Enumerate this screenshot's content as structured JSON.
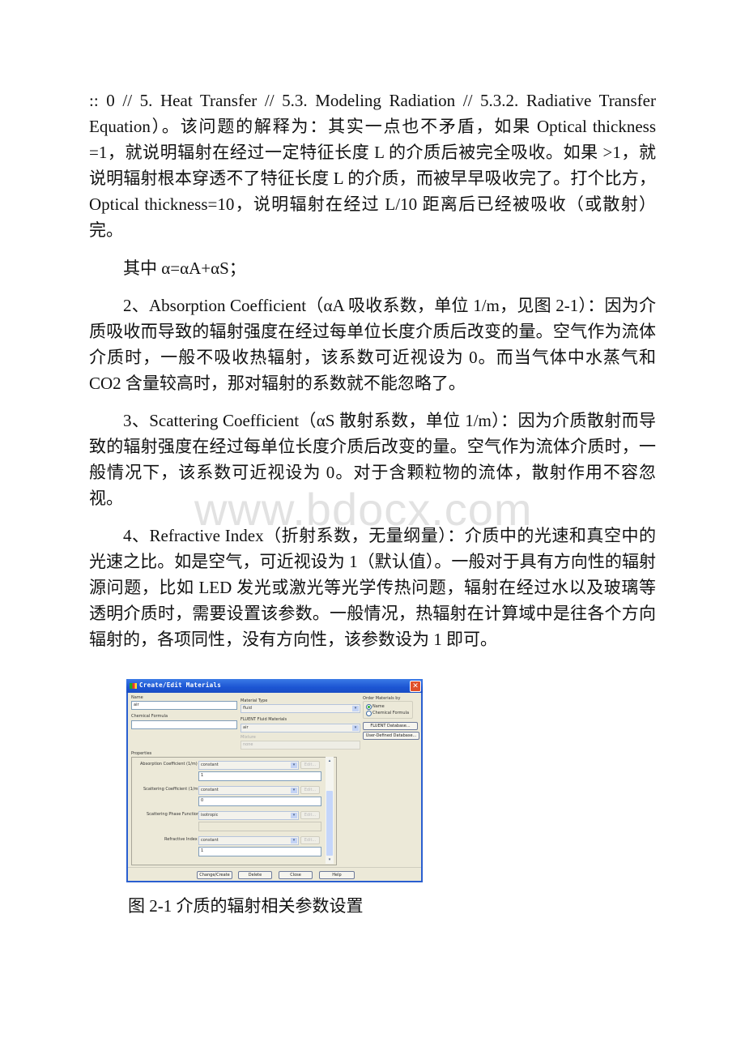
{
  "watermark": "www.bdocx.com",
  "paragraphs": [
    {
      "text": ":: 0 // 5. Heat Transfer // 5.3. Modeling Radiation // 5.3.2. Radiative Transfer Equation）。该问题的解释为：其实一点也不矛盾，如果 Optical thickness =1，就说明辐射在经过一定特征长度 L 的介质后被完全吸收。如果 >1，就说明辐射根本穿透不了特征长度 L 的介质，而被早早吸收完了。打个比方，Optical thickness=10，说明辐射在经过 L/10 距离后已经被吸收（或散射）完。"
    },
    {
      "text": "其中 α=αA+αS；"
    },
    {
      "text": "2、Absorption Coefficient（αA 吸收系数，单位 1/m，见图 2-1）：因为介质吸收而导致的辐射强度在经过每单位长度介质后改变的量。空气作为流体介质时，一般不吸收热辐射，该系数可近视设为 0。而当气体中水蒸气和 CO2 含量较高时，那对辐射的系数就不能忽略了。"
    },
    {
      "text": "3、Scattering Coefficient（αS 散射系数，单位 1/m）：因为介质散射而导致的辐射强度在经过每单位长度介质后改变的量。空气作为流体介质时，一般情况下，该系数可近视设为 0。对于含颗粒物的流体，散射作用不容忽视。"
    },
    {
      "text": "4、Refractive Index（折射系数，无量纲量）：介质中的光速和真空中的光速之比。如是空气，可近视设为 1（默认值）。一般对于具有方向性的辐射源问题，比如 LED 发光或激光等光学传热问题，辐射在经过水以及玻璃等透明介质时，需要设置该参数。一般情况，热辐射在计算域中是往各个方向辐射的，各项同性，没有方向性，该参数设为 1 即可。"
    }
  ],
  "figure": {
    "caption": "图 2-1 介质的辐射相关参数设置",
    "dialog": {
      "title": "Create/Edit Materials",
      "close_glyph": "✕",
      "name_label": "Name",
      "name_value": "air",
      "chemical_formula_label": "Chemical Formula",
      "chemical_formula_value": "",
      "material_type_label": "Material Type",
      "material_type_value": "fluid",
      "fluent_materials_label": "FLUENT Fluid Materials",
      "fluent_materials_value": "air",
      "mixture_label": "Mixture",
      "mixture_value": "none",
      "order_by_label": "Order Materials by",
      "order_by_options": [
        {
          "label": "Name",
          "selected": true
        },
        {
          "label": "Chemical Formula",
          "selected": false
        }
      ],
      "fluent_database_button": "FLUENT Database...",
      "user_database_button": "User-Defined Database...",
      "properties_label": "Properties",
      "properties": [
        {
          "label": "Absorption Coefficient (1/m)",
          "method": "constant",
          "value": "1",
          "edit": "Edit..."
        },
        {
          "label": "Scattering Coefficient (1/m)",
          "method": "constant",
          "value": "0",
          "edit": "Edit..."
        },
        {
          "label": "Scattering Phase Function",
          "method": "isotropic",
          "value": "",
          "edit": "Edit..."
        },
        {
          "label": "Refractive Index",
          "method": "constant",
          "value": "1",
          "edit": "Edit..."
        }
      ],
      "dropdown_glyph": "▾",
      "scroll_up_glyph": "▴",
      "scroll_down_glyph": "▾",
      "buttons": [
        "Change/Create",
        "Delete",
        "Close",
        "Help"
      ]
    }
  }
}
